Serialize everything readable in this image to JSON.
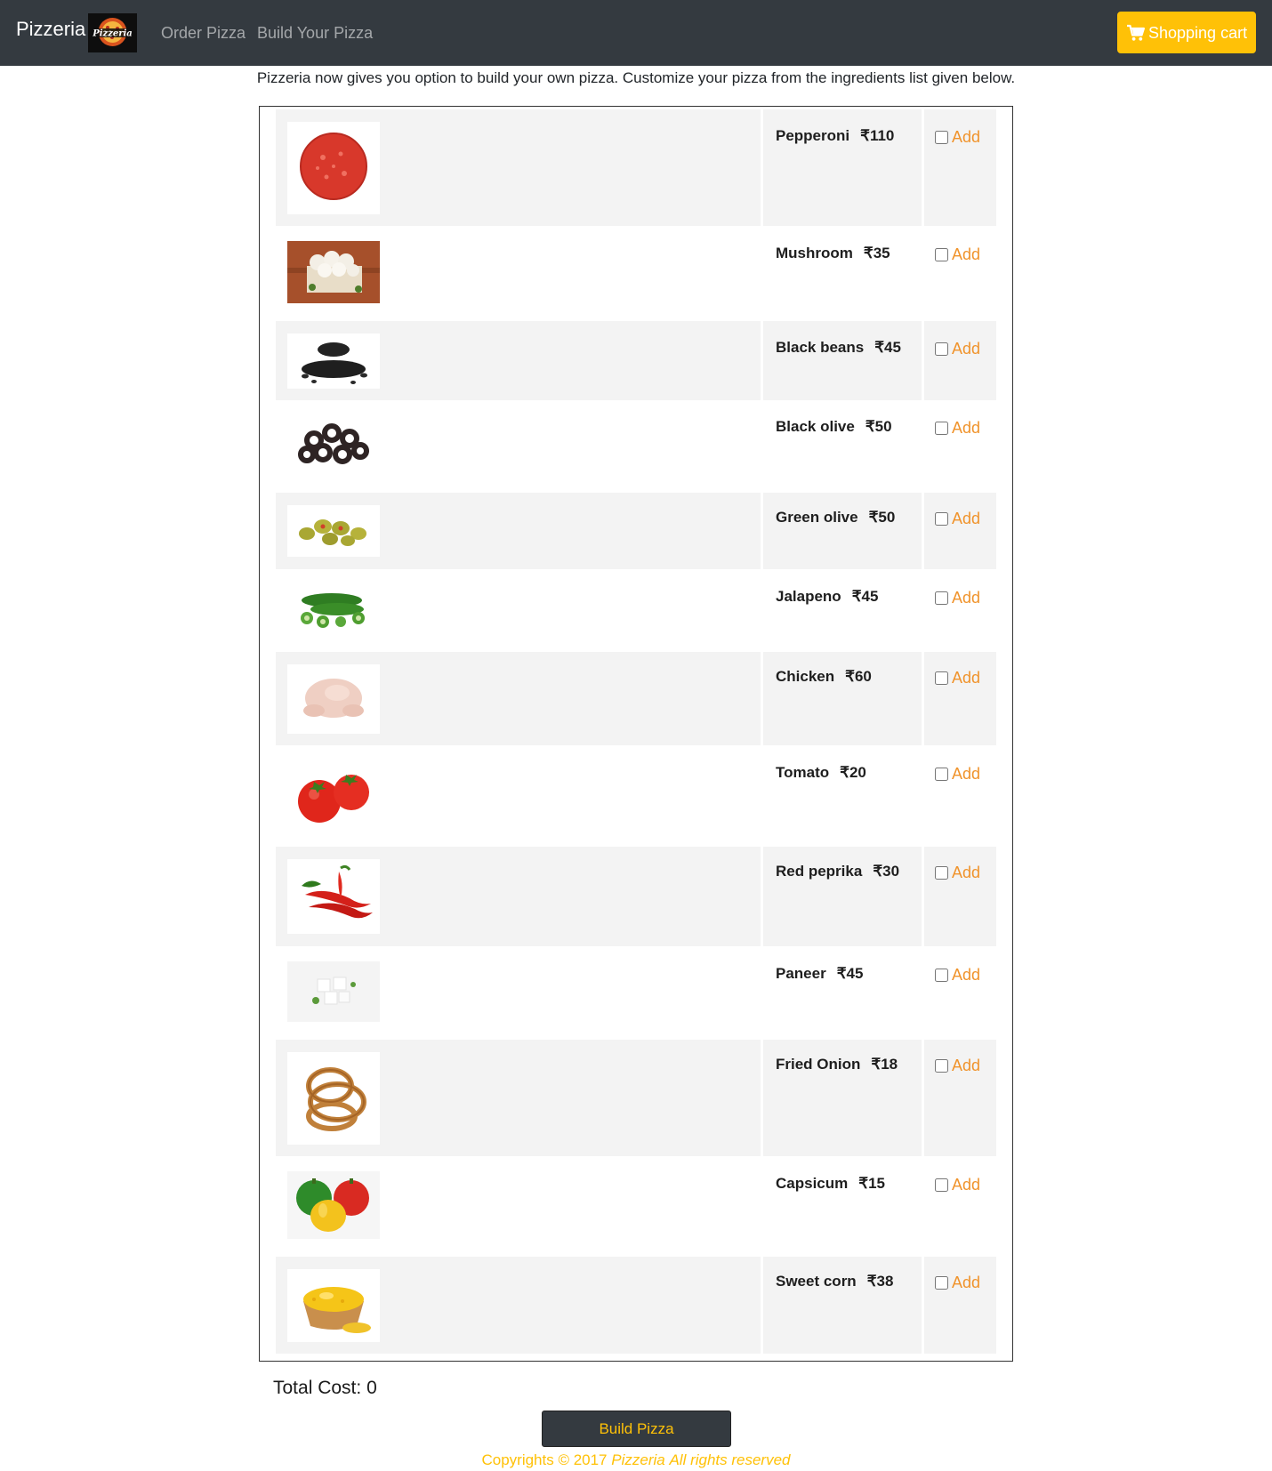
{
  "navbar": {
    "brand": "Pizzeria",
    "logo_text": "Pizzeria",
    "links": {
      "order": "Order Pizza",
      "build": "Build Your Pizza"
    },
    "cart": {
      "label": "Shopping cart",
      "icon": "cart-icon"
    },
    "colors": {
      "background": "#343a40",
      "cart": "#ffc107"
    }
  },
  "intro": "Pizzeria now gives you option to build your own pizza. Customize your pizza from the ingredients list given below.",
  "ingredients": [
    {
      "name": "Pepperoni",
      "price": "₹110",
      "add_label": "Add",
      "image": "pepperoni-image",
      "checked": false
    },
    {
      "name": "Mushroom",
      "price": "₹35",
      "add_label": "Add",
      "image": "mushroom-image",
      "checked": false
    },
    {
      "name": "Black beans",
      "price": "₹45",
      "add_label": "Add",
      "image": "black-beans-image",
      "checked": false
    },
    {
      "name": "Black olive",
      "price": "₹50",
      "add_label": "Add",
      "image": "black-olive-image",
      "checked": false
    },
    {
      "name": "Green olive",
      "price": "₹50",
      "add_label": "Add",
      "image": "green-olive-image",
      "checked": false
    },
    {
      "name": "Jalapeno",
      "price": "₹45",
      "add_label": "Add",
      "image": "jalapeno-image",
      "checked": false
    },
    {
      "name": "Chicken",
      "price": "₹60",
      "add_label": "Add",
      "image": "chicken-image",
      "checked": false
    },
    {
      "name": "Tomato",
      "price": "₹20",
      "add_label": "Add",
      "image": "tomato-image",
      "checked": false
    },
    {
      "name": "Red peprika",
      "price": "₹30",
      "add_label": "Add",
      "image": "red-paprika-image",
      "checked": false
    },
    {
      "name": "Paneer",
      "price": "₹45",
      "add_label": "Add",
      "image": "paneer-image",
      "checked": false
    },
    {
      "name": "Fried Onion",
      "price": "₹18",
      "add_label": "Add",
      "image": "fried-onion-image",
      "checked": false
    },
    {
      "name": "Capsicum",
      "price": "₹15",
      "add_label": "Add",
      "image": "capsicum-image",
      "checked": false
    },
    {
      "name": "Sweet corn",
      "price": "₹38",
      "add_label": "Add",
      "image": "sweet-corn-image",
      "checked": false
    }
  ],
  "total": {
    "label": "Total Cost:",
    "value": "0"
  },
  "build_button": "Build Pizza",
  "footer": {
    "prefix": "Copyrights © 2017",
    "brand": "Pizzeria",
    "suffix": "All rights reserved"
  },
  "colors": {
    "add": "#f0932b",
    "row_shade": "#f3f3f3",
    "accent": "#ffc107"
  }
}
